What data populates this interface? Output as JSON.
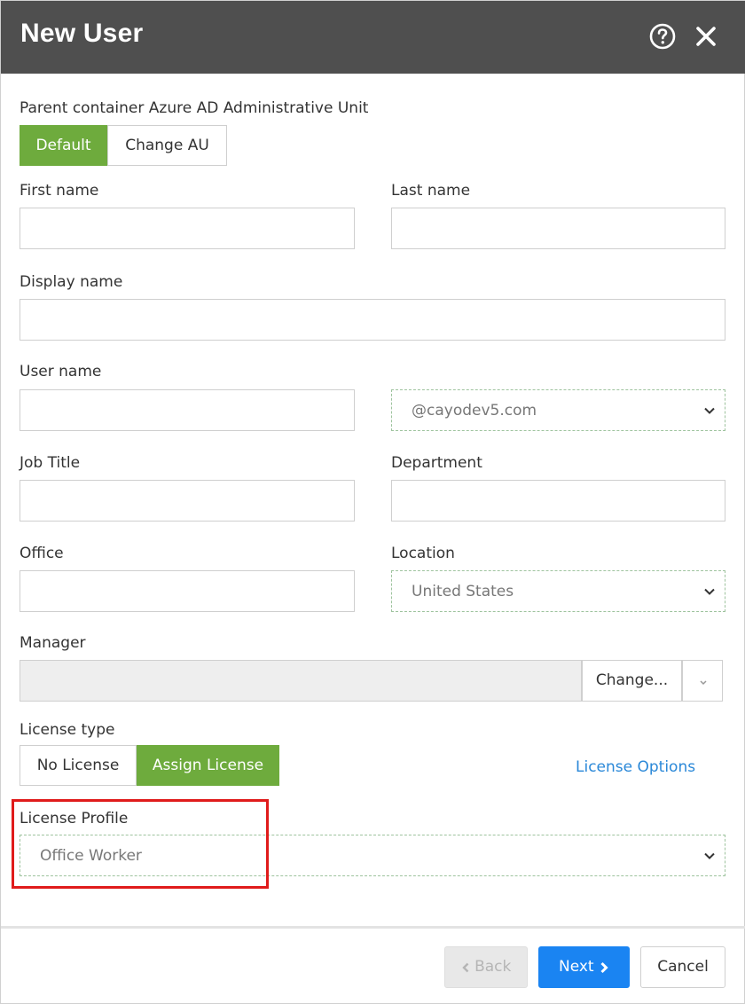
{
  "window": {
    "title": "New User",
    "icons": {
      "help": "help-circle-icon",
      "close": "close-icon"
    }
  },
  "parent_container": {
    "label": "Parent container Azure AD Administrative Unit",
    "options": [
      "Default",
      "Change AU"
    ],
    "selected": "Default"
  },
  "fields": {
    "first_name": {
      "label": "First name",
      "value": ""
    },
    "last_name": {
      "label": "Last name",
      "value": ""
    },
    "display_name": {
      "label": "Display name",
      "value": ""
    },
    "user_name": {
      "label": "User name",
      "value": "",
      "domain": "@cayodev5.com"
    },
    "job_title": {
      "label": "Job Title",
      "value": ""
    },
    "department": {
      "label": "Department",
      "value": ""
    },
    "office": {
      "label": "Office",
      "value": ""
    },
    "location": {
      "label": "Location",
      "value": "United States"
    },
    "manager": {
      "label": "Manager",
      "value": "",
      "change_label": "Change..."
    }
  },
  "license": {
    "type_label": "License type",
    "options": [
      "No License",
      "Assign License"
    ],
    "selected": "Assign License",
    "options_link": "License Options",
    "profile_label": "License Profile",
    "profile_value": "Office Worker"
  },
  "footer": {
    "back_label": "Back",
    "next_label": "Next",
    "cancel_label": "Cancel"
  },
  "colors": {
    "header_bg": "#4f4f4f",
    "accent_green": "#6eab3d",
    "primary_blue": "#1a84f2",
    "link_blue": "#2a88d8",
    "highlight_red": "#e01b1b"
  }
}
